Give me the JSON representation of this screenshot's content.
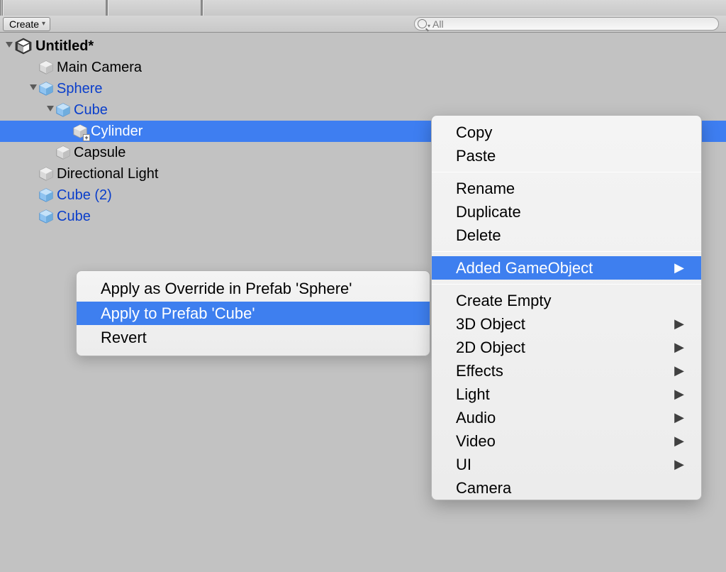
{
  "toolbar": {
    "create_label": "Create",
    "search_text": "All"
  },
  "hierarchy": {
    "scene": "Untitled*",
    "items": {
      "main_camera": "Main Camera",
      "sphere": "Sphere",
      "cube": "Cube",
      "cylinder": "Cylinder",
      "capsule": "Capsule",
      "directional_light": "Directional Light",
      "cube2": "Cube (2)",
      "cube_bottom": "Cube"
    }
  },
  "context": {
    "copy": "Copy",
    "paste": "Paste",
    "rename": "Rename",
    "duplicate": "Duplicate",
    "delete": "Delete",
    "added_gameobject": "Added GameObject",
    "create_empty": "Create Empty",
    "obj3d": "3D Object",
    "obj2d": "2D Object",
    "effects": "Effects",
    "light": "Light",
    "audio": "Audio",
    "video": "Video",
    "ui": "UI",
    "camera": "Camera"
  },
  "submenu": {
    "apply_override": "Apply as Override in Prefab 'Sphere'",
    "apply_prefab": "Apply to Prefab 'Cube'",
    "revert": "Revert"
  }
}
